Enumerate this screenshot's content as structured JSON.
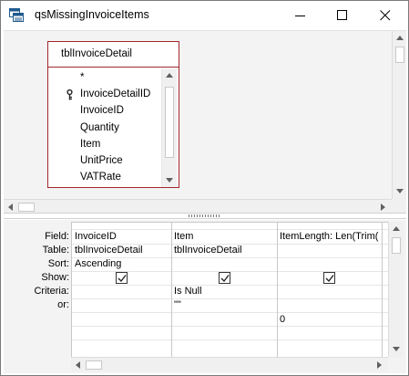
{
  "window": {
    "title": "qsMissingInvoiceItems",
    "controls": {
      "minimize_icon": "minimize-icon",
      "maximize_icon": "maximize-icon",
      "close_icon": "close-icon"
    }
  },
  "table_box": {
    "name": "tblInvoiceDetail",
    "fields": [
      {
        "label": "*",
        "key": false
      },
      {
        "label": "InvoiceDetailID",
        "key": true
      },
      {
        "label": "InvoiceID",
        "key": false
      },
      {
        "label": "Quantity",
        "key": false
      },
      {
        "label": "Item",
        "key": false
      },
      {
        "label": "UnitPrice",
        "key": false
      },
      {
        "label": "VATRate",
        "key": false
      }
    ]
  },
  "design_grid": {
    "row_labels": {
      "field": "Field:",
      "table": "Table:",
      "sort": "Sort:",
      "show": "Show:",
      "criteria": "Criteria:",
      "or": "or:"
    },
    "columns": [
      {
        "field": "InvoiceID",
        "table": "tblInvoiceDetail",
        "sort": "Ascending",
        "show": true,
        "criteria": "",
        "or": "",
        "extra": ""
      },
      {
        "field": "Item",
        "table": "tblInvoiceDetail",
        "sort": "",
        "show": true,
        "criteria": "Is Null",
        "or": "\"\"",
        "extra": ""
      },
      {
        "field": "ItemLength: Len(Trim(",
        "table": "",
        "sort": "",
        "show": true,
        "criteria": "",
        "or": "",
        "extra": "0"
      }
    ]
  },
  "colors": {
    "table_border": "#a4262c",
    "pane_background": "#f3f3f3"
  }
}
